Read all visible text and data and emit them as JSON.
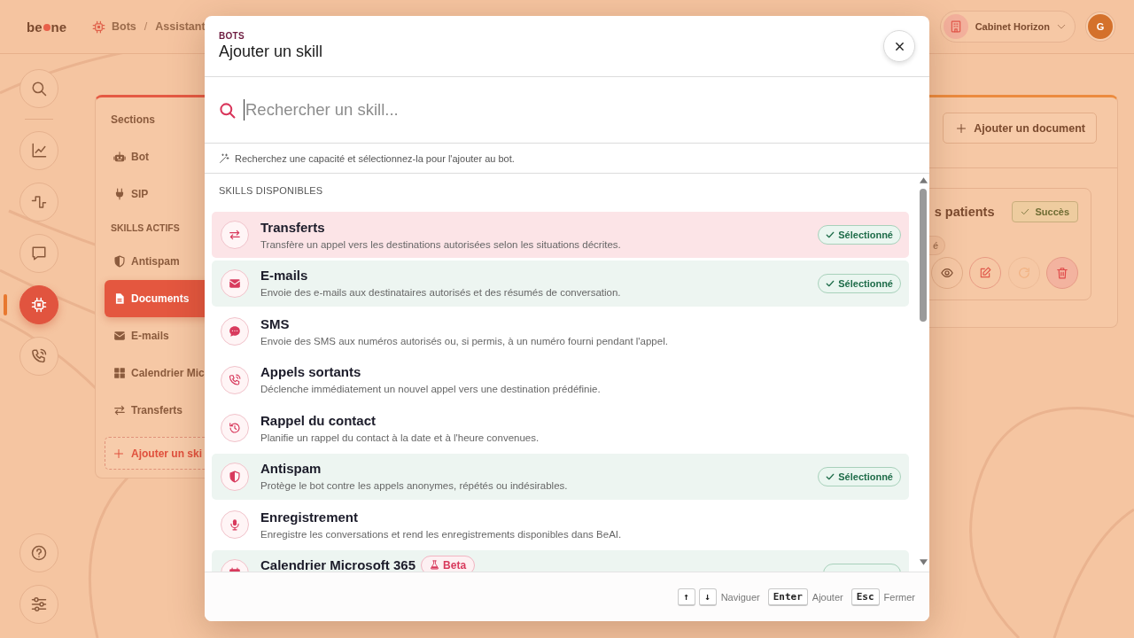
{
  "topbar": {
    "logo": {
      "left": "be",
      "right": "ne"
    },
    "breadcrumb": [
      "Bots",
      "Assistant"
    ],
    "separator": "/",
    "workspace": "Cabinet Horizon",
    "avatar": "G"
  },
  "rail": {
    "items": [
      {
        "kind": "search",
        "selected": false
      },
      {
        "kind": "chart",
        "selected": false
      },
      {
        "kind": "pulse",
        "selected": false
      },
      {
        "kind": "chat",
        "selected": false
      },
      {
        "kind": "chip",
        "selected": true
      },
      {
        "kind": "phone",
        "selected": false
      }
    ],
    "bottom": [
      {
        "kind": "help",
        "selected": false
      },
      {
        "kind": "sliders",
        "selected": false
      }
    ]
  },
  "sections_panel": {
    "heading": "Sections",
    "items": [
      {
        "kind": "robot",
        "label": "Bot",
        "selected": false
      },
      {
        "kind": "plug",
        "label": "SIP",
        "selected": false
      }
    ],
    "skills_heading": "SKILLS ACTIFS",
    "skills": [
      {
        "kind": "shield",
        "label": "Antispam",
        "selected": false
      },
      {
        "kind": "file",
        "label": "Documents",
        "selected": true
      },
      {
        "kind": "mail",
        "label": "E-mails",
        "selected": false
      },
      {
        "kind": "grid",
        "label": "Calendrier Mic",
        "selected": false
      },
      {
        "kind": "transfer",
        "label": "Transferts",
        "selected": false
      }
    ],
    "add_button": "Ajouter un ski"
  },
  "documents_card": {
    "add_button": "Ajouter un document",
    "document": {
      "title": "s patients",
      "status": "Succès",
      "tag": "é",
      "actions": [
        {
          "kind": "view",
          "disabled": false
        },
        {
          "kind": "edit",
          "disabled": false
        },
        {
          "kind": "retry",
          "disabled": true
        },
        {
          "kind": "delete",
          "disabled": false
        }
      ]
    }
  },
  "modal": {
    "eyebrow": "BOTS",
    "title": "Ajouter un skill",
    "search": {
      "placeholder": "Rechercher un skill..."
    },
    "hint": "Recherchez une capacité et sélectionnez-la pour l'ajouter au bot.",
    "section_label": "SKILLS DISPONIBLES",
    "skills": [
      {
        "kind": "transfer",
        "name": "Transferts",
        "description": "Transfère un appel vers les destinations autorisées selon les situations décrites.",
        "highlighted": true,
        "selected": true,
        "badge": "Sélectionné"
      },
      {
        "kind": "mail",
        "name": "E-mails",
        "description": "Envoie des e-mails aux destinataires autorisés et des résumés de conversation.",
        "highlighted": false,
        "selected": true,
        "badge": "Sélectionné"
      },
      {
        "kind": "sms",
        "name": "SMS",
        "description": "Envoie des SMS aux numéros autorisés ou, si permis, à un numéro fourni pendant l'appel.",
        "highlighted": false,
        "selected": false
      },
      {
        "kind": "phone",
        "name": "Appels sortants",
        "description": "Déclenche immédiatement un nouvel appel vers une destination prédéfinie.",
        "highlighted": false,
        "selected": false
      },
      {
        "kind": "history",
        "name": "Rappel du contact",
        "description": "Planifie un rappel du contact à la date et à l'heure convenues.",
        "highlighted": false,
        "selected": false
      },
      {
        "kind": "shield",
        "name": "Antispam",
        "description": "Protège le bot contre les appels anonymes, répétés ou indésirables.",
        "highlighted": false,
        "selected": true,
        "badge": "Sélectionné"
      },
      {
        "kind": "mic",
        "name": "Enregistrement",
        "description": "Enregistre les conversations et rend les enregistrements disponibles dans BeAI.",
        "highlighted": false,
        "selected": false
      },
      {
        "kind": "calendar",
        "name": "Calendrier Microsoft 365",
        "tag": "Beta",
        "highlighted": false,
        "selected": true
      }
    ],
    "footer": [
      {
        "keys": [
          "↑",
          "↓"
        ],
        "label": "Naviguer"
      },
      {
        "keys": [
          "Enter"
        ],
        "label": "Ajouter"
      },
      {
        "keys": [
          "Esc"
        ],
        "label": "Fermer"
      }
    ]
  }
}
